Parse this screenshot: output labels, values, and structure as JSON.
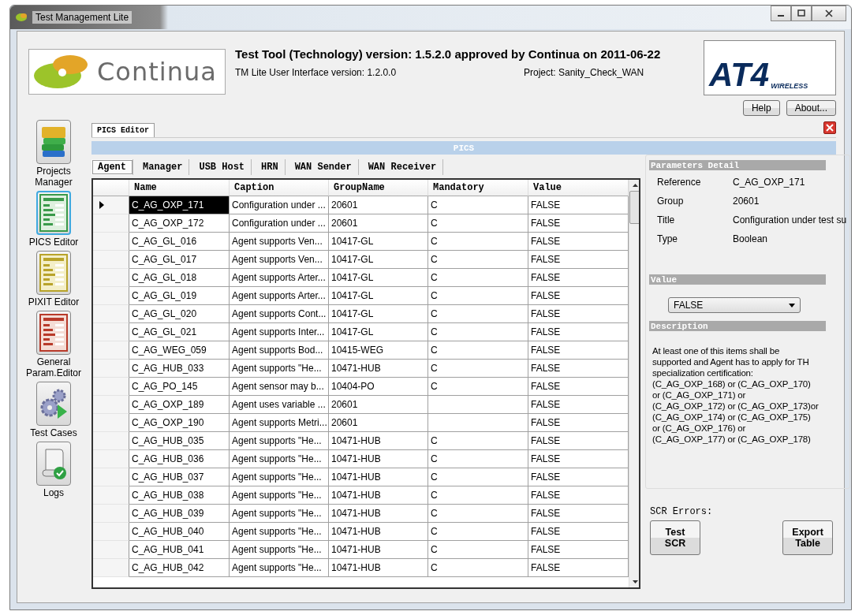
{
  "window": {
    "title": "Test Management Lite"
  },
  "header": {
    "logo_text": "Continua",
    "headline": "Test Tool (Technology) version: 1.5.2.0 approved by Continua on 2011-06-22",
    "ui_version": "TM Lite User Interface version: 1.2.0.0",
    "project": "Project: Sanity_Check_WAN",
    "brand_text": "AT4",
    "brand_subtext": "WIRELESS",
    "buttons": [
      "Help",
      "About..."
    ]
  },
  "sidebar": {
    "items": [
      {
        "label": "Projects Manager",
        "kind": "books",
        "selected": false
      },
      {
        "label": "PICS Editor",
        "kind": "green-sheet",
        "selected": true
      },
      {
        "label": "PIXIT Editor",
        "kind": "yellow-sheet",
        "selected": false
      },
      {
        "label": "General Param.Editor",
        "kind": "red-sheet",
        "selected": false
      },
      {
        "label": "Test Cases",
        "kind": "gears",
        "selected": false
      },
      {
        "label": "Logs",
        "kind": "scroll",
        "selected": false
      }
    ]
  },
  "editor_tab": {
    "label": "PICS Editor",
    "selected": true
  },
  "section_title": "PICS",
  "subtabs": [
    {
      "label": "Agent",
      "selected": true
    },
    {
      "label": "Manager",
      "selected": false
    },
    {
      "label": "USB Host",
      "selected": false
    },
    {
      "label": "HRN",
      "selected": false
    },
    {
      "label": "WAN Sender",
      "selected": false
    },
    {
      "label": "WAN Receiver",
      "selected": false
    }
  ],
  "table": {
    "columns": [
      "Name",
      "Caption",
      "GroupName",
      "Mandatory",
      "Value"
    ],
    "rows": [
      {
        "name": "C_AG_OXP_171",
        "caption": "Configuration under ...",
        "group": "20601",
        "mandatory": "C",
        "value": "FALSE",
        "selected": true
      },
      {
        "name": "C_AG_OXP_172",
        "caption": "Configuration under ...",
        "group": "20601",
        "mandatory": "C",
        "value": "FALSE",
        "selected": false
      },
      {
        "name": "C_AG_GL_016",
        "caption": "Agent supports Ven...",
        "group": "10417-GL",
        "mandatory": "C",
        "value": "FALSE",
        "selected": false
      },
      {
        "name": "C_AG_GL_017",
        "caption": "Agent supports Ven...",
        "group": "10417-GL",
        "mandatory": "C",
        "value": "FALSE",
        "selected": false
      },
      {
        "name": "C_AG_GL_018",
        "caption": "Agent supports Arter...",
        "group": "10417-GL",
        "mandatory": "C",
        "value": "FALSE",
        "selected": false
      },
      {
        "name": "C_AG_GL_019",
        "caption": "Agent supports Arter...",
        "group": "10417-GL",
        "mandatory": "C",
        "value": "FALSE",
        "selected": false
      },
      {
        "name": "C_AG_GL_020",
        "caption": "Agent supports Cont...",
        "group": "10417-GL",
        "mandatory": "C",
        "value": "FALSE",
        "selected": false
      },
      {
        "name": "C_AG_GL_021",
        "caption": "Agent supports Inter...",
        "group": "10417-GL",
        "mandatory": "C",
        "value": "FALSE",
        "selected": false
      },
      {
        "name": "C_AG_WEG_059",
        "caption": "Agent supports Bod...",
        "group": "10415-WEG",
        "mandatory": "C",
        "value": "FALSE",
        "selected": false
      },
      {
        "name": "C_AG_HUB_033",
        "caption": "Agent supports \"He...",
        "group": "10471-HUB",
        "mandatory": "C",
        "value": "FALSE",
        "selected": false
      },
      {
        "name": "C_AG_PO_145",
        "caption": "Agent sensor may b...",
        "group": "10404-PO",
        "mandatory": "C",
        "value": "FALSE",
        "selected": false
      },
      {
        "name": "C_AG_OXP_189",
        "caption": "Agent uses variable ...",
        "group": "20601",
        "value": "FALSE",
        "selected": false
      },
      {
        "name": "C_AG_OXP_190",
        "caption": "Agent supports Metri...",
        "group": "20601",
        "value": "FALSE",
        "selected": false
      },
      {
        "name": "C_AG_HUB_035",
        "caption": "Agent supports \"He...",
        "group": "10471-HUB",
        "mandatory": "C",
        "value": "FALSE",
        "selected": false
      },
      {
        "name": "C_AG_HUB_036",
        "caption": "Agent supports \"He...",
        "group": "10471-HUB",
        "mandatory": "C",
        "value": "FALSE",
        "selected": false
      },
      {
        "name": "C_AG_HUB_037",
        "caption": "Agent supports \"He...",
        "group": "10471-HUB",
        "mandatory": "C",
        "value": "FALSE",
        "selected": false
      },
      {
        "name": "C_AG_HUB_038",
        "caption": "Agent supports \"He...",
        "group": "10471-HUB",
        "mandatory": "C",
        "value": "FALSE",
        "selected": false
      },
      {
        "name": "C_AG_HUB_039",
        "caption": "Agent supports \"He...",
        "group": "10471-HUB",
        "mandatory": "C",
        "value": "FALSE",
        "selected": false
      },
      {
        "name": "C_AG_HUB_040",
        "caption": "Agent supports \"He...",
        "group": "10471-HUB",
        "mandatory": "C",
        "value": "FALSE",
        "selected": false
      },
      {
        "name": "C_AG_HUB_041",
        "caption": "Agent supports \"He...",
        "group": "10471-HUB",
        "mandatory": "C",
        "value": "FALSE",
        "selected": false
      },
      {
        "name": "C_AG_HUB_042",
        "caption": "Agent supports \"He...",
        "group": "10471-HUB",
        "mandatory": "C",
        "value": "FALSE",
        "selected": false
      }
    ]
  },
  "details": {
    "title": "Parameters Detail",
    "fields": [
      {
        "label": "Reference",
        "value": "C_AG_OXP_171"
      },
      {
        "label": "Group",
        "value": "20601"
      },
      {
        "label": "Title",
        "value": "Configuration under test su"
      },
      {
        "label": "Type",
        "value": "Boolean"
      }
    ],
    "value_title": "Value",
    "value": "FALSE",
    "description_title": "Description",
    "description": "At least one of this items shall be supported and Agent has to apply for TH specialization certification:\n(C_AG_OXP_168) or (C_AG_OXP_170)\nor (C_AG_OXP_171) or\n(C_AG_OXP_172) or (C_AG_OXP_173)or\n(C_AG_OXP_174) or (C_AG_OXP_175)\nor (C_AG_OXP_176) or\n(C_AG_OXP_177) or (C_AG_OXP_178)"
  },
  "scr_errors_label": "SCR Errors:",
  "actions": [
    "Test SCR",
    "Export Table"
  ]
}
